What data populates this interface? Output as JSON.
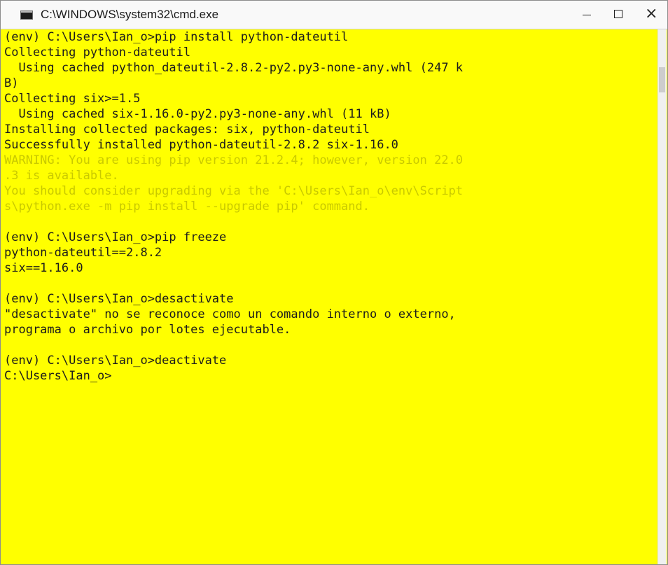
{
  "window": {
    "title": "C:\\WINDOWS\\system32\\cmd.exe",
    "icon": "cmd-icon",
    "icon_label": "C:\\",
    "controls": {
      "minimize": "minimize-icon",
      "maximize": "maximize-icon",
      "close": "close-icon",
      "close_glyph": "×"
    }
  },
  "console": {
    "background": "#ffff00",
    "lines": [
      {
        "text": "(env) C:\\Users\\Ian_o>pip install python-dateutil",
        "style": "normal"
      },
      {
        "text": "Collecting python-dateutil",
        "style": "normal"
      },
      {
        "text": "  Using cached python_dateutil-2.8.2-py2.py3-none-any.whl (247 k",
        "style": "normal"
      },
      {
        "text": "B)",
        "style": "normal"
      },
      {
        "text": "Collecting six>=1.5",
        "style": "normal"
      },
      {
        "text": "  Using cached six-1.16.0-py2.py3-none-any.whl (11 kB)",
        "style": "normal"
      },
      {
        "text": "Installing collected packages: six, python-dateutil",
        "style": "normal"
      },
      {
        "text": "Successfully installed python-dateutil-2.8.2 six-1.16.0",
        "style": "normal"
      },
      {
        "text": "WARNING: You are using pip version 21.2.4; however, version 22.0",
        "style": "dim"
      },
      {
        "text": ".3 is available.",
        "style": "dim"
      },
      {
        "text": "You should consider upgrading via the 'C:\\Users\\Ian_o\\env\\Script",
        "style": "dim"
      },
      {
        "text": "s\\python.exe -m pip install --upgrade pip' command.",
        "style": "dim"
      },
      {
        "text": "",
        "style": "normal"
      },
      {
        "text": "(env) C:\\Users\\Ian_o>pip freeze",
        "style": "normal"
      },
      {
        "text": "python-dateutil==2.8.2",
        "style": "normal"
      },
      {
        "text": "six==1.16.0",
        "style": "normal"
      },
      {
        "text": "",
        "style": "normal"
      },
      {
        "text": "(env) C:\\Users\\Ian_o>desactivate",
        "style": "normal"
      },
      {
        "text": "\"desactivate\" no se reconoce como un comando interno o externo,",
        "style": "normal"
      },
      {
        "text": "programa o archivo por lotes ejecutable.",
        "style": "normal"
      },
      {
        "text": "",
        "style": "normal"
      },
      {
        "text": "(env) C:\\Users\\Ian_o>deactivate",
        "style": "normal"
      },
      {
        "text": "C:\\Users\\Ian_o>",
        "style": "normal"
      }
    ]
  }
}
